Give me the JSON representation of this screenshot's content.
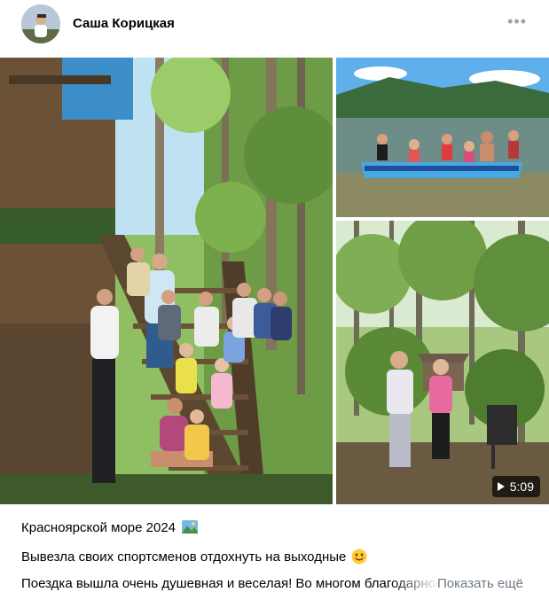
{
  "post": {
    "author": "Саша Корицкая",
    "menu_icon": "more-horizontal-icon",
    "video_duration": "5:09",
    "lines": [
      "Красноярской море 2024",
      "Вывезла своих спортсменов отдохнуть на выходные",
      "Поездка вышла очень душевная и веселая! Во многом благодарность"
    ],
    "show_more": "Показать ещё"
  },
  "colors": {
    "accent": "#2688eb",
    "secondary_text": "#6f7985",
    "sky": "#4aa3df",
    "water": "#6b8a8c",
    "forest": "#3f6b2e"
  }
}
